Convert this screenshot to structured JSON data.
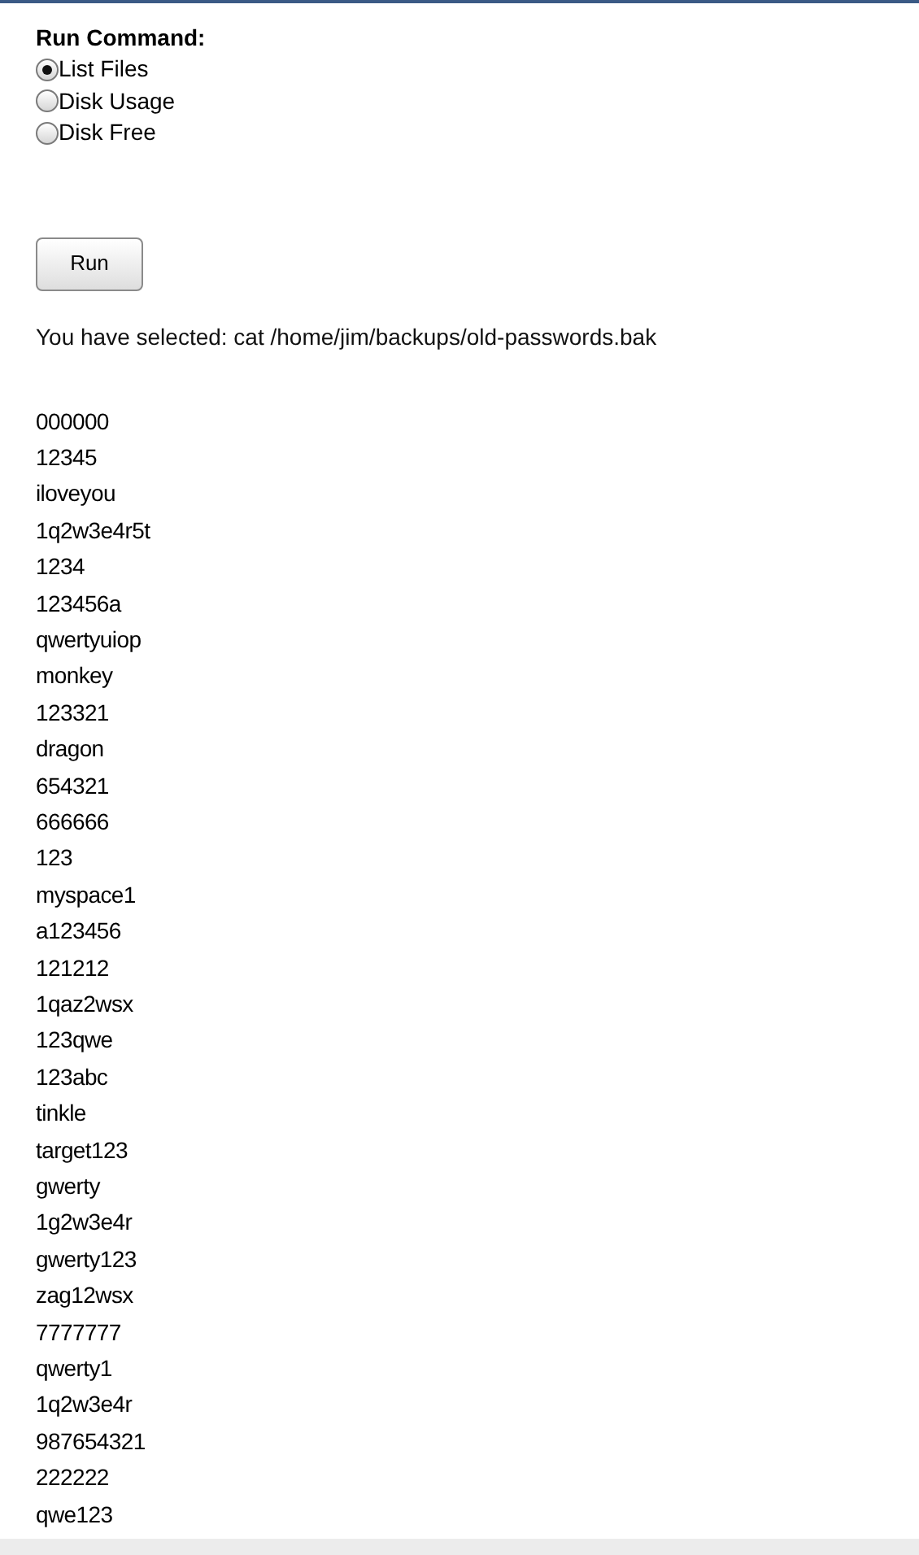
{
  "heading": "Run Command:",
  "options": [
    {
      "label": "List Files",
      "selected": true
    },
    {
      "label": "Disk Usage",
      "selected": false
    },
    {
      "label": "Disk Free",
      "selected": false
    }
  ],
  "button": "Run",
  "selected_text": "You have selected: cat /home/jim/backups/old-passwords.bak",
  "output_lines": [
    "000000",
    "12345",
    "iloveyou",
    "1q2w3e4r5t",
    "1234",
    "123456a",
    "qwertyuiop",
    "monkey",
    "123321",
    "dragon",
    "654321",
    "666666",
    "123",
    "myspace1",
    "a123456",
    "121212",
    "1qaz2wsx",
    "123qwe",
    "123abc",
    "tinkle",
    "target123",
    "gwerty",
    "1g2w3e4r",
    "gwerty123",
    "zag12wsx",
    "7777777",
    "qwerty1",
    "1q2w3e4r",
    "987654321",
    "222222",
    "qwe123"
  ]
}
